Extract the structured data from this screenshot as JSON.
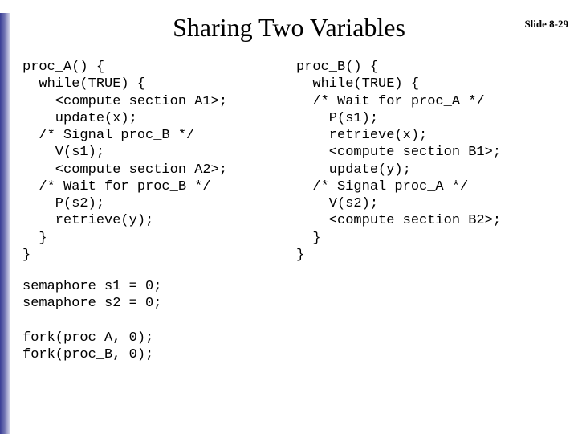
{
  "slide_number": "Slide 8-29",
  "title": "Sharing Two Variables",
  "proc_a": "proc_A() {\n  while(TRUE) {\n    <compute section A1>;\n    update(x);\n  /* Signal proc_B */\n    V(s1);\n    <compute section A2>;\n  /* Wait for proc_B */\n    P(s2);\n    retrieve(y);\n  }\n}",
  "proc_b": "proc_B() {\n  while(TRUE) {\n  /* Wait for proc_A */\n    P(s1);\n    retrieve(x);\n    <compute section B1>;\n    update(y);\n  /* Signal proc_A */\n    V(s2);\n    <compute section B2>;\n  }\n}",
  "bottom": "semaphore s1 = 0;\nsemaphore s2 = 0;\n\nfork(proc_A, 0);\nfork(proc_B, 0);"
}
